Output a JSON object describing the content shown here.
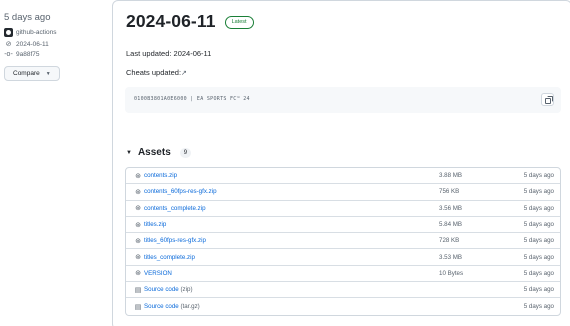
{
  "sidebar": {
    "age": "5 days ago",
    "author": "github-actions",
    "tag": "2024-06-11",
    "commit": "9a88f75",
    "compare_label": "Compare"
  },
  "release": {
    "title": "2024-06-11",
    "badge": "Latest",
    "updated_label": "Last updated: 2024-06-11",
    "cheats_label": "Cheats updated:",
    "cheats_link": "↗",
    "code_line": "0100B3801A0E6000 | EA SPORTS FC™ 24"
  },
  "assets": {
    "label": "Assets",
    "count": "9",
    "items": [
      {
        "icon": "package-icon",
        "name": "contents.zip",
        "ext": "",
        "size": "3.88 MB",
        "date": "5 days ago"
      },
      {
        "icon": "package-icon",
        "name": "contents_60fps-res-gfx.zip",
        "ext": "",
        "size": "756 KB",
        "date": "5 days ago"
      },
      {
        "icon": "package-icon",
        "name": "contents_complete.zip",
        "ext": "",
        "size": "3.56 MB",
        "date": "5 days ago"
      },
      {
        "icon": "package-icon",
        "name": "titles.zip",
        "ext": "",
        "size": "5.84 MB",
        "date": "5 days ago"
      },
      {
        "icon": "package-icon",
        "name": "titles_60fps-res-gfx.zip",
        "ext": "",
        "size": "728 KB",
        "date": "5 days ago"
      },
      {
        "icon": "package-icon",
        "name": "titles_complete.zip",
        "ext": "",
        "size": "3.53 MB",
        "date": "5 days ago"
      },
      {
        "icon": "package-icon",
        "name": "VERSION",
        "ext": "",
        "size": "10 Bytes",
        "date": "5 days ago"
      },
      {
        "icon": "file-zip-icon",
        "name": "Source code ",
        "ext": "(zip)",
        "size": "",
        "date": "5 days ago"
      },
      {
        "icon": "file-zip-icon",
        "name": "Source code ",
        "ext": "(tar.gz)",
        "size": "",
        "date": "5 days ago"
      }
    ]
  },
  "colors": {
    "link": "#0969da",
    "latest": "#1a7f37",
    "muted": "#59636e",
    "border": "#d0d7de"
  }
}
